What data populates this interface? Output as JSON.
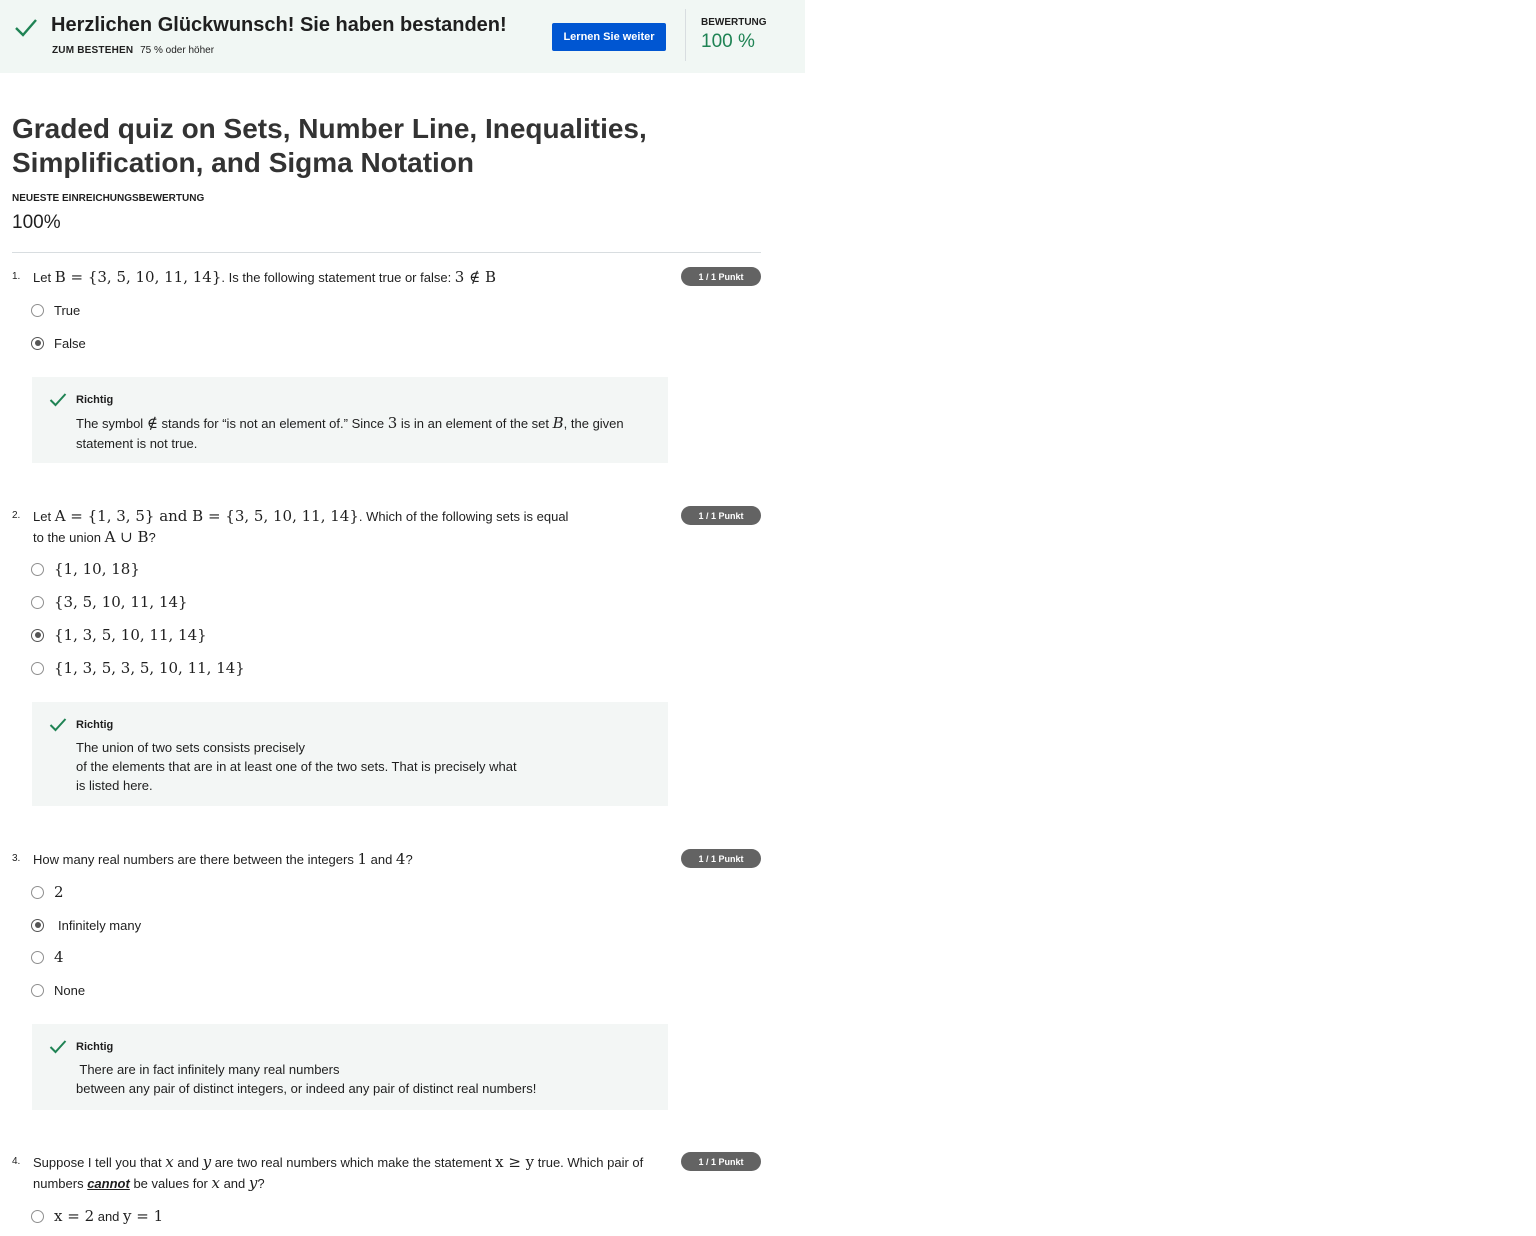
{
  "banner": {
    "headline": "Herzlichen Glückwunsch! Sie haben bestanden!",
    "pass_label": "ZUM BESTEHEN",
    "pass_value": "75 % oder höher",
    "continue_label": "Lernen Sie weiter",
    "grade_label": "BEWERTUNG",
    "grade_value": "100 %",
    "accent_color": "#1f8354",
    "button_color": "#0056d2"
  },
  "quiz": {
    "title": "Graded quiz on Sets, Number Line, Inequalities, Simplification, and Sigma Notation",
    "latest_label": "NEUESTE EINREICHUNGSBEWERTUNG",
    "latest_value": "100%"
  },
  "questions": [
    {
      "number": "1.",
      "points": "1 / 1 Punkt",
      "text": [
        "Let ",
        "B = {3, 5, 10, 11, 14}",
        ". Is the following statement true or false: ",
        "3 ∉ B"
      ],
      "options": [
        {
          "label": "True",
          "selected": false
        },
        {
          "label": "False",
          "selected": true
        }
      ],
      "feedback_title": "Richtig",
      "feedback": [
        "The symbol ",
        "∉",
        " stands for “is not an element of.” Since ",
        "3",
        " is in an element of the set ",
        "B",
        ", the given",
        "statement is not true."
      ]
    },
    {
      "number": "2.",
      "points": "1 / 1 Punkt",
      "text": [
        "Let ",
        "A = {1, 3, 5}",
        " and ",
        "B = {3, 5, 10, 11, 14}",
        ". Which of the following sets is equal",
        "to the union ",
        "A ∪ B",
        "?"
      ],
      "options": [
        {
          "label": "{1, 10, 18}",
          "selected": false
        },
        {
          "label": "{3, 5, 10, 11, 14}",
          "selected": false
        },
        {
          "label": "{1, 3, 5, 10, 11, 14}",
          "selected": true
        },
        {
          "label": "{1, 3, 5, 3, 5, 10, 11, 14}",
          "selected": false
        }
      ],
      "feedback_title": "Richtig",
      "feedback": [
        "The union of two sets consists precisely",
        "of the elements that are in at least one of the two sets. That is precisely what",
        "is listed here."
      ]
    },
    {
      "number": "3.",
      "points": "1 / 1 Punkt",
      "text": [
        "How many real numbers are there between the integers ",
        "1",
        " and ",
        "4",
        "?"
      ],
      "options": [
        {
          "label": "2",
          "selected": false
        },
        {
          "label": "Infinitely many",
          "selected": true
        },
        {
          "label": "4",
          "selected": false
        },
        {
          "label": "None",
          "selected": false
        }
      ],
      "feedback_title": "Richtig",
      "feedback": [
        " There are in fact infinitely many real numbers",
        "between any pair of distinct integers, or indeed any pair of distinct real numbers!"
      ]
    },
    {
      "number": "4.",
      "points": "1 / 1 Punkt",
      "text": [
        "Suppose I tell you that ",
        "x",
        " and ",
        "y",
        " are two real numbers which make the statement ",
        "x ≥ y",
        " true. Which pair of",
        "numbers ",
        "cannot",
        " be values for ",
        "x",
        " and ",
        "y",
        "?"
      ],
      "options": [
        {
          "label": [
            "x = 2",
            " and ",
            "y = 1"
          ],
          "selected": false
        }
      ]
    }
  ]
}
